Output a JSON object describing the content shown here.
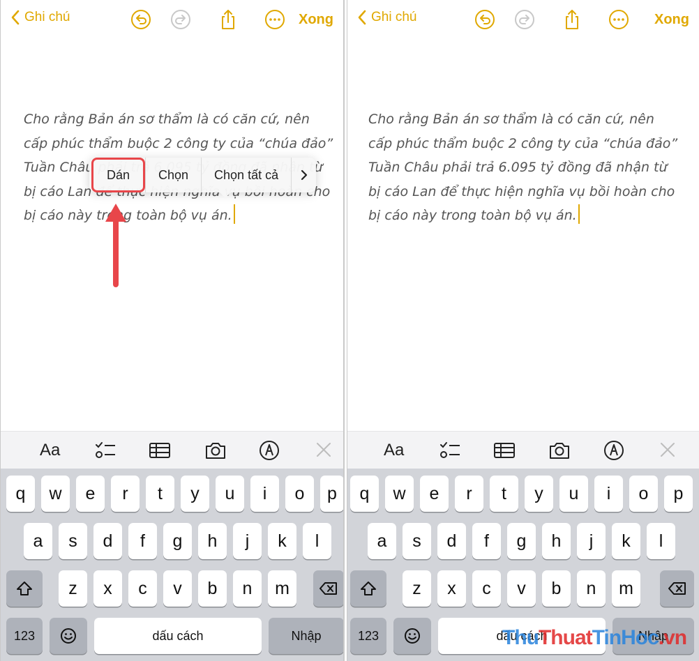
{
  "colors": {
    "accent": "#e0a800",
    "highlight": "#e8464a",
    "keyboard_bg": "#d2d4d9"
  },
  "nav": {
    "back_label": "Ghi chú",
    "done_label": "Xong",
    "icons": [
      "undo-icon",
      "redo-icon",
      "share-icon",
      "more-icon"
    ]
  },
  "left": {
    "note_text": "Cho rằng Bản án sơ thẩm là có căn cứ, nên cấp phúc thẩm buộc 2 công ty của “chúa đảo” Tuần Châu phải trả 6.095 tỷ đồng đã nhận từ bị cáo Lan để thực hiện nghĩa vụ bồi hoàn cho bị cáo này trong toàn bộ vụ án.",
    "menu": {
      "paste": "Dán",
      "select": "Chọn",
      "select_all": "Chọn tất cả"
    }
  },
  "right": {
    "note_text": "Cho rằng Bản án sơ thẩm là có căn cứ, nên cấp phúc thẩm buộc 2 công ty của “chúa đảo” Tuần Châu phải trả 6.095 tỷ đồng đã nhận từ bị cáo Lan để thực hiện nghĩa vụ bồi hoàn cho bị cáo này trong toàn bộ vụ án."
  },
  "toolbar": {
    "format_label": "Aa",
    "icons": [
      "checklist-icon",
      "table-icon",
      "camera-icon",
      "markup-icon",
      "close-icon"
    ]
  },
  "keyboard": {
    "row1": [
      "q",
      "w",
      "e",
      "r",
      "t",
      "y",
      "u",
      "i",
      "o",
      "p"
    ],
    "row2": [
      "a",
      "s",
      "d",
      "f",
      "g",
      "h",
      "j",
      "k",
      "l"
    ],
    "row3": [
      "z",
      "x",
      "c",
      "v",
      "b",
      "n",
      "m"
    ],
    "numbers_label": "123",
    "space_label": "dấu cách",
    "return_label": "Nhập"
  },
  "watermark": {
    "part1": "Thu",
    "part2": "Thuat",
    "part3": "TinHoc",
    "part4": ".vn"
  }
}
